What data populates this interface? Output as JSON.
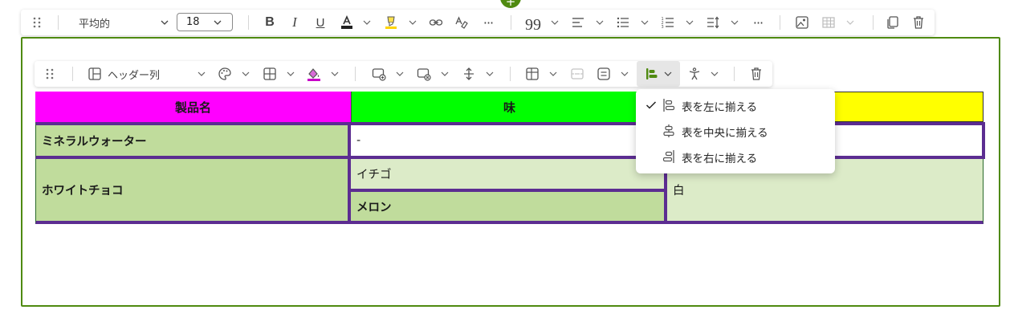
{
  "top_toolbar": {
    "style_label": "平均的",
    "font_size_value": "18"
  },
  "table_toolbar": {
    "header_column_label": "ヘッダー列"
  },
  "table": {
    "headers": [
      "製品名",
      "味",
      ""
    ],
    "rows": [
      {
        "name": "ミネラルウォーター",
        "flavor": "-",
        "color": ""
      },
      {
        "name": "ホワイトチョコ",
        "flavors": [
          "イチゴ",
          "メロン"
        ],
        "color": "白"
      }
    ],
    "colors": {
      "header_name_bg": "#ff00ff",
      "header_flavor_bg": "#00ff00",
      "header_color_bg": "#ffff00",
      "row_label_bg": "#c0dc9c",
      "light_cell_bg": "#dcebc8",
      "border_accent": "#5c2d91",
      "frame_border": "#4f8a10"
    }
  },
  "align_menu": {
    "items": [
      {
        "label": "表を左に揃える",
        "checked": true
      },
      {
        "label": "表を中央に揃える",
        "checked": false
      },
      {
        "label": "表を右に揃える",
        "checked": false
      }
    ]
  }
}
